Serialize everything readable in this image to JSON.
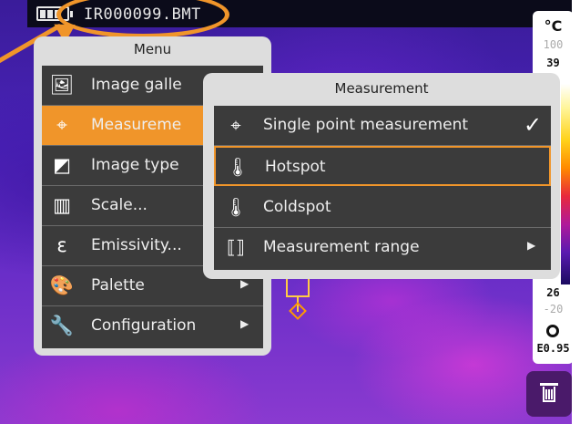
{
  "statusbar": {
    "filename": "IR000099.BMT",
    "battery_icon": "battery-icon"
  },
  "annotation": {
    "color": "#f0952a",
    "target": "filename"
  },
  "scale": {
    "unit": "°C",
    "range_max": "100",
    "top_value": "39",
    "bottom_value": "26",
    "range_min": "-20",
    "emissivity": "E0.95",
    "auto_icon": "auto-range-icon"
  },
  "delete": {
    "icon": "trash-icon"
  },
  "menu": {
    "title": "Menu",
    "items": [
      {
        "label": "Image galle",
        "icon": "image-gallery-icon",
        "selected": false,
        "submenu": false
      },
      {
        "label": "Measureme",
        "icon": "measurement-icon",
        "selected": true,
        "submenu": false
      },
      {
        "label": "Image type",
        "icon": "image-type-icon",
        "selected": false,
        "submenu": false
      },
      {
        "label": "Scale...",
        "icon": "scale-icon",
        "selected": false,
        "submenu": false
      },
      {
        "label": "Emissivity...",
        "icon": "emissivity-icon",
        "selected": false,
        "submenu": false
      },
      {
        "label": "Palette",
        "icon": "palette-icon",
        "selected": false,
        "submenu": true
      },
      {
        "label": "Configuration",
        "icon": "wrench-icon",
        "selected": false,
        "submenu": true
      }
    ]
  },
  "submenu": {
    "title": "Measurement",
    "items": [
      {
        "label": "Single point measurement",
        "icon": "single-point-icon",
        "checked": true,
        "selected": false,
        "submenu": false
      },
      {
        "label": "Hotspot",
        "icon": "hotspot-icon",
        "checked": false,
        "selected": true,
        "submenu": false
      },
      {
        "label": "Coldspot",
        "icon": "coldspot-icon",
        "checked": false,
        "selected": false,
        "submenu": false
      },
      {
        "label": "Measurement range",
        "icon": "measurement-range-icon",
        "checked": false,
        "selected": false,
        "submenu": true
      }
    ]
  },
  "colors": {
    "accent": "#f0952a",
    "menu_bg": "#3b3b3b",
    "menu_frame": "#dddddd"
  }
}
